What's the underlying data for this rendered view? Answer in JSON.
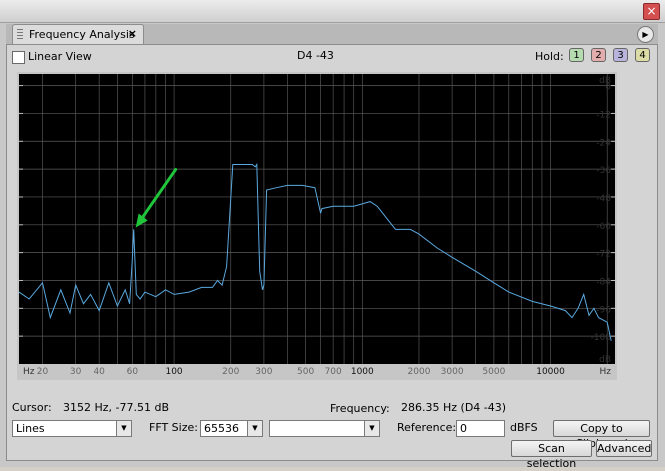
{
  "window": {
    "close_glyph": "×"
  },
  "tab": {
    "label": "Frequency Analysis",
    "close_glyph": "×",
    "menu_glyph": "▶"
  },
  "toolbar": {
    "linear_view_label": "Linear View",
    "linear_view_checked": false,
    "note_readout": "D4 -43",
    "hold_label": "Hold:",
    "hold_buttons": [
      {
        "label": "1",
        "color": "#b5dcae"
      },
      {
        "label": "2",
        "color": "#e3adad"
      },
      {
        "label": "3",
        "color": "#b8b4dc"
      },
      {
        "label": "4",
        "color": "#dcdca6"
      }
    ]
  },
  "chart_data": {
    "type": "line",
    "x_scale": "log",
    "xlim": [
      15,
      22000
    ],
    "ylim": [
      -120,
      5
    ],
    "xtick_labels": [
      {
        "value": 20,
        "label": "20"
      },
      {
        "value": 30,
        "label": "30"
      },
      {
        "value": 40,
        "label": "40"
      },
      {
        "value": 60,
        "label": "60"
      },
      {
        "value": 100,
        "label": "100"
      },
      {
        "value": 200,
        "label": "200"
      },
      {
        "value": 300,
        "label": "300"
      },
      {
        "value": 500,
        "label": "500"
      },
      {
        "value": 700,
        "label": "700"
      },
      {
        "value": 1000,
        "label": "1000"
      },
      {
        "value": 2000,
        "label": "2000"
      },
      {
        "value": 3000,
        "label": "3000"
      },
      {
        "value": 5000,
        "label": "5000"
      },
      {
        "value": 10000,
        "label": "10000"
      }
    ],
    "x_unit": "Hz",
    "ytick_labels": [
      0,
      -12,
      -24,
      -36,
      -48,
      -60,
      -72,
      -84,
      -96,
      -108
    ],
    "y_unit": "dB",
    "grid": true,
    "background": "#000000",
    "line_color": "#59a9e0",
    "arrow_color": "#1fc63a",
    "series": [
      {
        "x": [
          15,
          17,
          20,
          22,
          25,
          28,
          30,
          33,
          36,
          40,
          45,
          50,
          55,
          58,
          60,
          61,
          63,
          66,
          70,
          80,
          90,
          100,
          120,
          140,
          160,
          170,
          180,
          190,
          205,
          230,
          260,
          270,
          275,
          285,
          295,
          300,
          310,
          350,
          400,
          480,
          560,
          600,
          610,
          700,
          800,
          900,
          1000,
          1100,
          1200,
          1500,
          1800,
          2000,
          2500,
          3000,
          4000,
          5000,
          6000,
          8000,
          10000,
          12000,
          13000,
          14000,
          15000,
          16000,
          17000,
          18000,
          20000,
          21000
        ],
        "y": [
          -89,
          -92,
          -85,
          -100,
          -88,
          -98,
          -86,
          -94,
          -90,
          -97,
          -85,
          -95,
          -88,
          -94,
          -75,
          -62,
          -90,
          -92,
          -89,
          -91,
          -88,
          -90,
          -89,
          -87,
          -87,
          -84,
          -86,
          -78,
          -34,
          -34,
          -34,
          -35,
          -34,
          -80,
          -88,
          -86,
          -45,
          -44,
          -43,
          -43,
          -44,
          -55,
          -53,
          -52,
          -52,
          -52,
          -51,
          -50,
          -52,
          -62,
          -62,
          -64,
          -70,
          -74,
          -80,
          -85,
          -89,
          -93,
          -95,
          -97,
          -100,
          -96,
          -90,
          -99,
          -96,
          -100,
          -102,
          -110
        ]
      }
    ]
  },
  "status": {
    "cursor_label": "Cursor:",
    "cursor_value": "3152 Hz, -77.51 dB",
    "frequency_label": "Frequency:",
    "frequency_value": "286.35 Hz (D4 -43)"
  },
  "controls": {
    "display_mode": "Lines",
    "fft_label": "FFT Size:",
    "fft_value": "65536",
    "window_value": "",
    "reference_label": "Reference:",
    "reference_value": "0",
    "reference_unit": "dBFS",
    "copy_button": "Copy to Clipboard",
    "scan_button": "Scan selection",
    "advanced_button": "Advanced"
  }
}
